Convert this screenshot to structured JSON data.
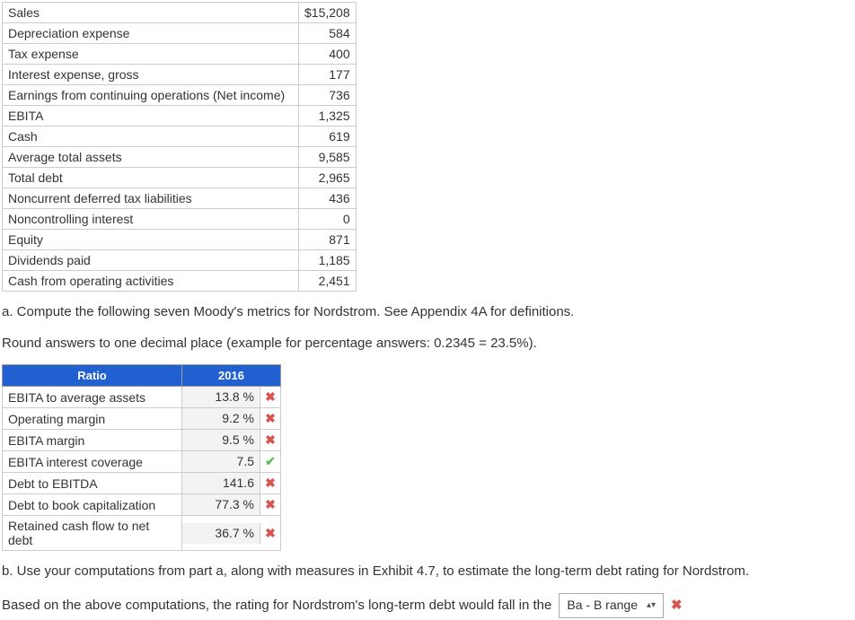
{
  "financials": {
    "rows": [
      {
        "label": "Sales",
        "value": "$15,208"
      },
      {
        "label": "Depreciation expense",
        "value": "584"
      },
      {
        "label": "Tax expense",
        "value": "400"
      },
      {
        "label": "Interest expense, gross",
        "value": "177"
      },
      {
        "label": "Earnings from continuing operations (Net income)",
        "value": "736"
      },
      {
        "label": "EBITA",
        "value": "1,325"
      },
      {
        "label": "Cash",
        "value": "619"
      },
      {
        "label": "Average total assets",
        "value": "9,585"
      },
      {
        "label": "Total debt",
        "value": "2,965"
      },
      {
        "label": "Noncurrent deferred tax liabilities",
        "value": "436"
      },
      {
        "label": "Noncontrolling interest",
        "value": "0"
      },
      {
        "label": "Equity",
        "value": "871"
      },
      {
        "label": "Dividends paid",
        "value": "1,185"
      },
      {
        "label": "Cash from operating activities",
        "value": "2,451"
      }
    ]
  },
  "instructions": {
    "a": "a. Compute the following seven Moody's metrics for Nordstrom. See Appendix 4A for definitions.",
    "round": "Round answers to one decimal place (example for percentage answers: 0.2345 = 23.5%).",
    "b": "b. Use your computations from part a, along with measures in Exhibit 4.7, to estimate the long-term debt rating for Nordstrom."
  },
  "ratio_header": {
    "col1": "Ratio",
    "col2": "2016"
  },
  "ratios": {
    "rows": [
      {
        "label": "EBITA to average assets",
        "value": "13.8 %",
        "status": "x"
      },
      {
        "label": "Operating margin",
        "value": "9.2 %",
        "status": "x"
      },
      {
        "label": "EBITA margin",
        "value": "9.5 %",
        "status": "x"
      },
      {
        "label": "EBITA interest coverage",
        "value": "7.5",
        "status": "check"
      },
      {
        "label": "Debt to EBITDA",
        "value": "141.6",
        "status": "x"
      },
      {
        "label": "Debt to book capitalization",
        "value": "77.3 %",
        "status": "x"
      },
      {
        "label": "Retained cash flow to net debt",
        "value": "36.7 %",
        "status": "x"
      }
    ]
  },
  "final": {
    "prefix": "Based on the above computations, the rating for Nordstrom's long-term debt would fall in the",
    "selected": "Ba - B range",
    "status": "x"
  },
  "icons": {
    "x": "✖",
    "check": "✔",
    "updown": "♦"
  }
}
